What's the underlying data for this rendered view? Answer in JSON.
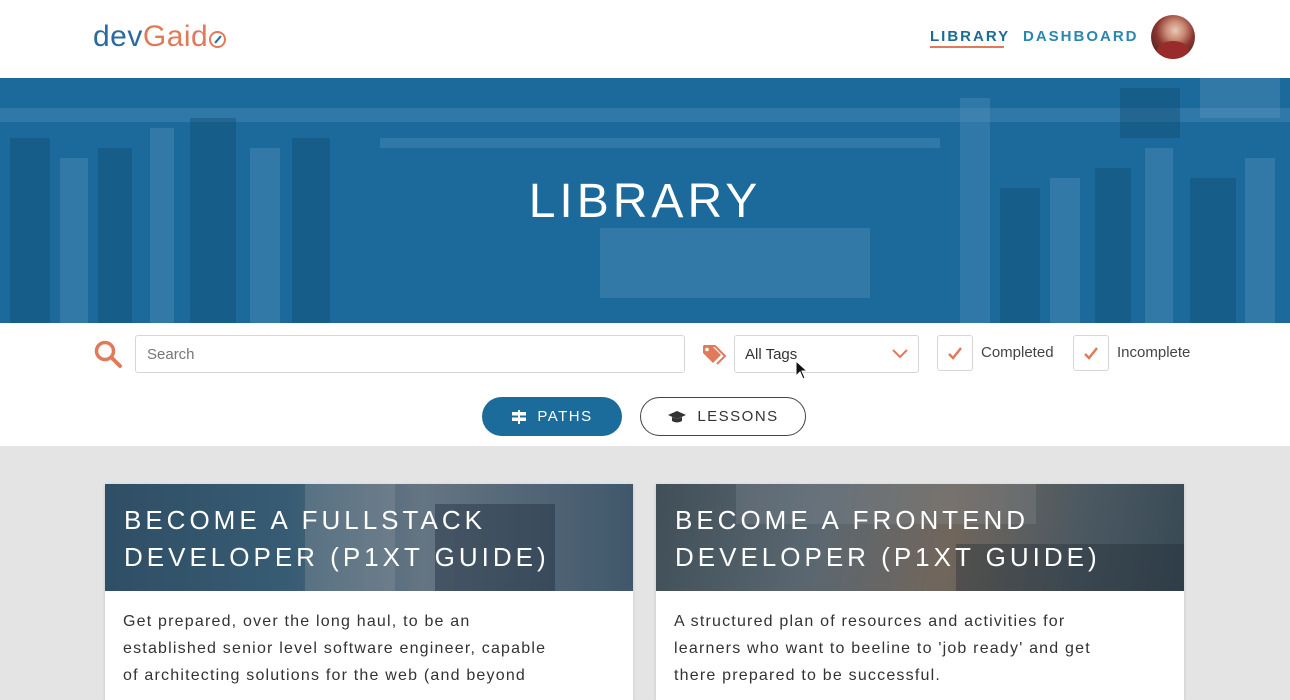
{
  "header": {
    "logo_dev": "dev",
    "logo_gaido": "Gaid",
    "nav": {
      "library": "LIBRARY",
      "dashboard": "DASHBOARD"
    }
  },
  "hero": {
    "title": "LIBRARY"
  },
  "filters": {
    "search_placeholder": "Search",
    "tags_selected": "All Tags",
    "completed_label": "Completed",
    "incomplete_label": "Incomplete",
    "completed_checked": true,
    "incomplete_checked": true
  },
  "toggles": {
    "paths": "PATHS",
    "lessons": "LESSONS",
    "active": "paths"
  },
  "cards": [
    {
      "title_line1": "BECOME A FULLSTACK",
      "title_line2": "DEVELOPER (P1XT GUIDE)",
      "desc_line1": "Get prepared, over the long haul, to be an",
      "desc_line2": "established senior level software engineer, capable",
      "desc_line3": "of architecting solutions for the web (and beyond"
    },
    {
      "title_line1": "BECOME A FRONTEND",
      "title_line2": "DEVELOPER (P1XT GUIDE)",
      "desc_line1": "A structured plan of resources and activities for",
      "desc_line2": "learners who want to beeline to 'job ready' and get",
      "desc_line3": "there prepared to be successful."
    }
  ],
  "colors": {
    "brand_blue": "#1b6c9b",
    "accent_orange": "#e07a5a",
    "nav_blue": "#2a87b0"
  }
}
